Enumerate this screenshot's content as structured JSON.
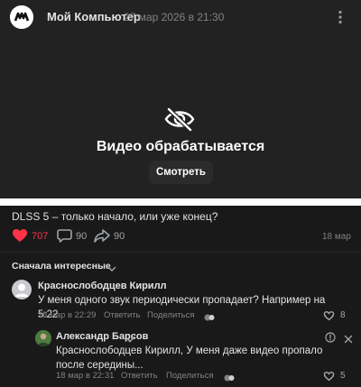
{
  "post": {
    "author": "Мой Компьютер",
    "date": "27 мар 2026 в 21:30",
    "text": "DLSS 5 – только начало, или уже конец?",
    "likes": "707",
    "comments": "90",
    "shares": "90",
    "posted": "18 мар"
  },
  "video": {
    "status": "Видео обрабатывается",
    "watch_label": "Смотреть"
  },
  "comments_section": {
    "sort_label": "Сначала интересные"
  },
  "comments": [
    {
      "author": "Краснослободцев Кирилл",
      "text": "У меня одного звук периодически пропадает? Например на 5:22",
      "time": "18 мар в 22:29",
      "reply_label": "Ответить",
      "share_label": "Поделиться",
      "likes": "8"
    },
    {
      "author": "Александр Барсов",
      "text": "Краснослободцев Кирилл, У меня даже видео пропало после середины...",
      "time": "18 мар в 22:31",
      "reply_label": "Ответить",
      "share_label": "Поделиться",
      "likes": "5"
    }
  ],
  "colors": {
    "background": "#191919",
    "panel": "#222222",
    "like_active": "#ff3347",
    "muted_text": "#828282"
  }
}
